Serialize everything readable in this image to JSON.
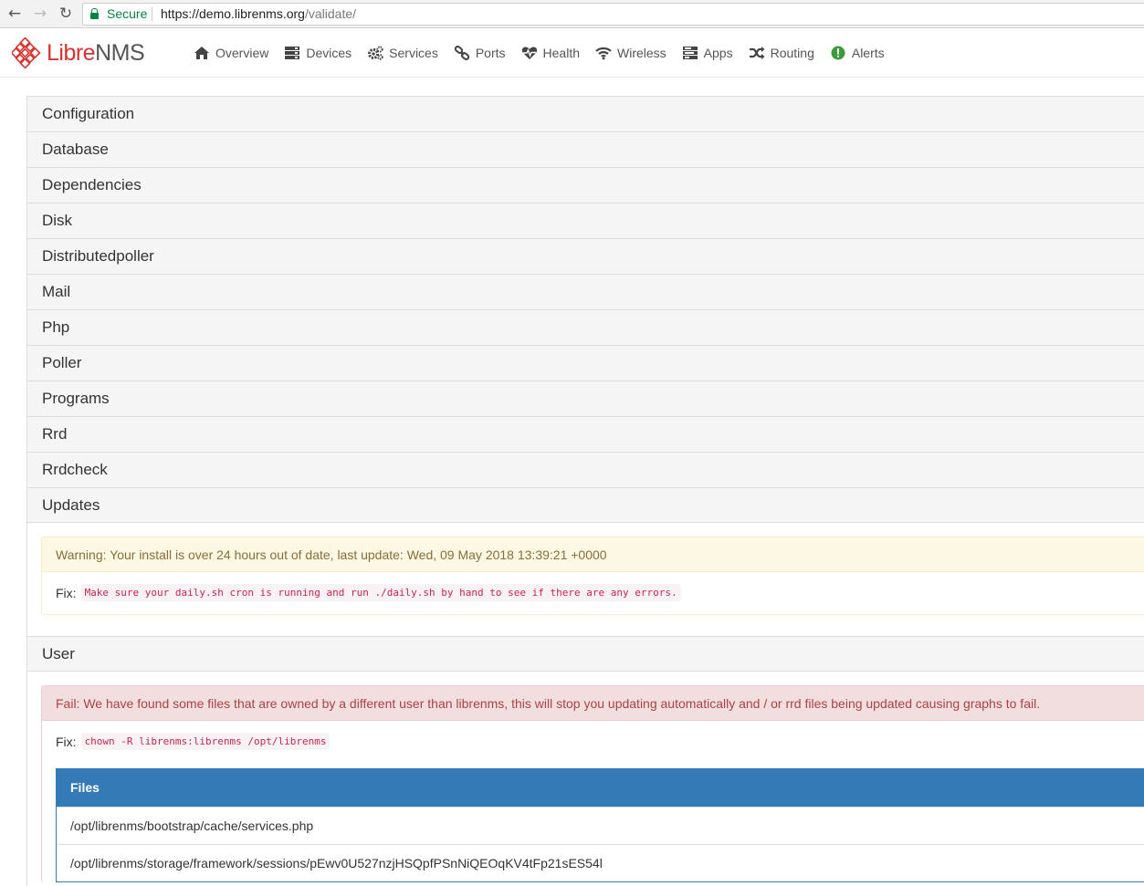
{
  "browser": {
    "secure_label": "Secure",
    "url_host": "https://demo.librenms.org",
    "url_path": "/validate/"
  },
  "app": {
    "logo_accent": "Libre",
    "logo_rest": "NMS",
    "menu": [
      {
        "label": "Overview",
        "icon": "home-icon"
      },
      {
        "label": "Devices",
        "icon": "server-icon"
      },
      {
        "label": "Services",
        "icon": "cogs-icon"
      },
      {
        "label": "Ports",
        "icon": "link-icon"
      },
      {
        "label": "Health",
        "icon": "heartbeat-icon"
      },
      {
        "label": "Wireless",
        "icon": "wifi-icon"
      },
      {
        "label": "Apps",
        "icon": "tasks-icon"
      },
      {
        "label": "Routing",
        "icon": "random-icon"
      },
      {
        "label": "Alerts",
        "icon": "exclamation-circle-icon"
      }
    ]
  },
  "sections": [
    "Configuration",
    "Database",
    "Dependencies",
    "Disk",
    "Distributedpoller",
    "Mail",
    "Php",
    "Poller",
    "Programs",
    "Rrd",
    "Rrdcheck"
  ],
  "updates": {
    "title": "Updates",
    "warning": "Warning: Your install is over 24 hours out of date, last update: Wed, 09 May 2018 13:39:21 +0000",
    "fix_label": "Fix:",
    "fix_code": "Make sure your daily.sh cron is running and run ./daily.sh by hand to see if there are any errors."
  },
  "user": {
    "title": "User",
    "fail": "Fail: We have found some files that are owned by a different user than librenms, this will stop you updating automatically and / or rrd files being updated causing graphs to fail.",
    "fix_label": "Fix:",
    "fix_code": "chown -R librenms:librenms /opt/librenms",
    "files_header": "Files",
    "files": [
      "/opt/librenms/bootstrap/cache/services.php",
      "/opt/librenms/storage/framework/sessions/pEwv0U527nzjHSQpfPSnNiQEOqKV4tFp21sES54l"
    ]
  },
  "colors": {
    "brand_red": "#d9322f",
    "primary": "#337ab7",
    "warning_bg": "#fcf8e3",
    "danger_bg": "#f2dede"
  }
}
